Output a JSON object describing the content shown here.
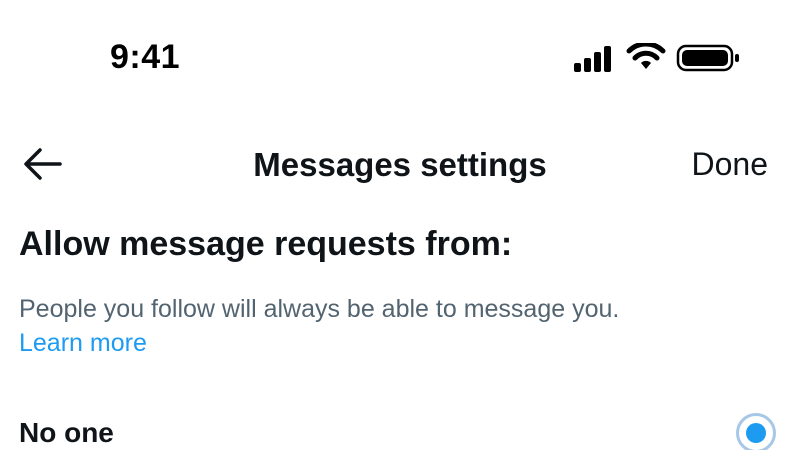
{
  "status_bar": {
    "time": "9:41",
    "icons": [
      "cellular-signal-icon",
      "wifi-icon",
      "battery-icon"
    ]
  },
  "header": {
    "back_icon": "arrow-left-icon",
    "title": "Messages settings",
    "done_label": "Done"
  },
  "section": {
    "heading": "Allow message requests from:",
    "description": "People you follow will always be able to message you.",
    "learn_more": "Learn more"
  },
  "options": [
    {
      "label": "No one",
      "selected": true
    }
  ],
  "colors": {
    "accent": "#1d9bf0",
    "text_primary": "#0f1419",
    "text_secondary": "#536471",
    "radio_ring": "#a7c7e7"
  }
}
